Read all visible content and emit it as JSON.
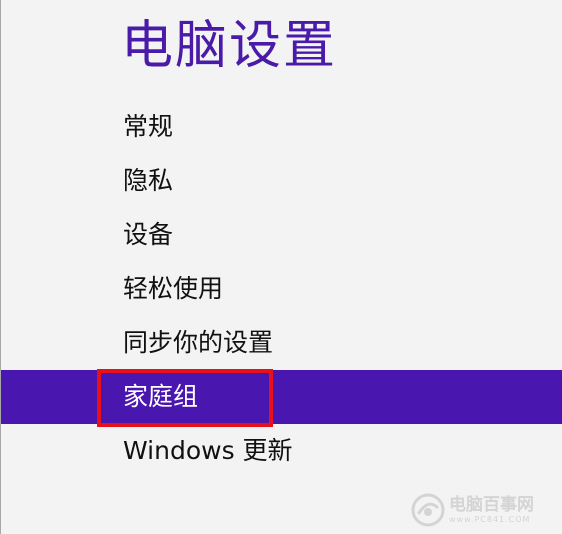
{
  "page": {
    "title": "电脑设置"
  },
  "nav": {
    "items": [
      {
        "label": "常规"
      },
      {
        "label": "隐私"
      },
      {
        "label": "设备"
      },
      {
        "label": "轻松使用"
      },
      {
        "label": "同步你的设置"
      },
      {
        "label": "家庭组",
        "selected": true
      },
      {
        "label": "Windows 更新"
      }
    ]
  },
  "watermark": {
    "text": "电脑百事网",
    "subtext": "www.PC841.COM"
  },
  "colors": {
    "accent": "#4a16b0",
    "title": "#4a1aa8",
    "highlight": "#e8101a",
    "background": "#f3f3f3"
  }
}
